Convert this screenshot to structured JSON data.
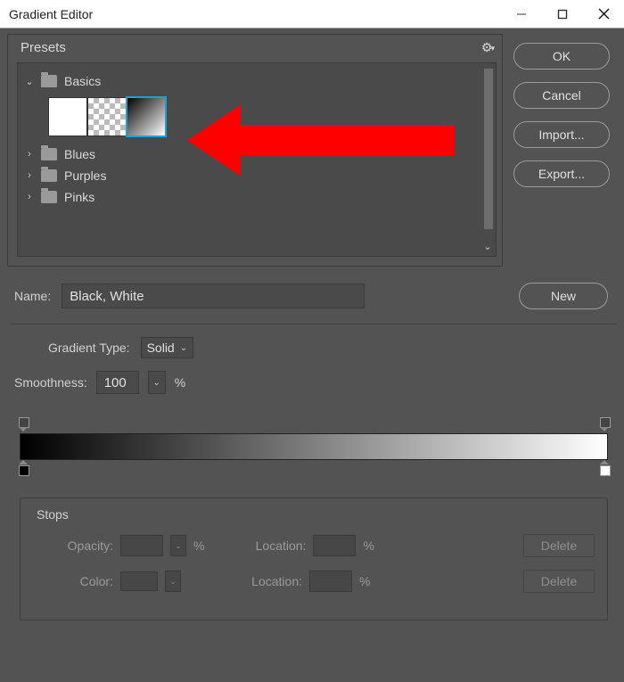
{
  "window": {
    "title": "Gradient Editor"
  },
  "buttons": {
    "ok": "OK",
    "cancel": "Cancel",
    "import": "Import...",
    "export": "Export...",
    "new": "New",
    "delete": "Delete"
  },
  "presets": {
    "label": "Presets",
    "folders": [
      {
        "name": "Basics",
        "expanded": true
      },
      {
        "name": "Blues",
        "expanded": false
      },
      {
        "name": "Purples",
        "expanded": false
      },
      {
        "name": "Pinks",
        "expanded": false
      }
    ]
  },
  "name": {
    "label": "Name:",
    "value": "Black, White"
  },
  "gradient_type": {
    "label": "Gradient Type:",
    "value": "Solid"
  },
  "smoothness": {
    "label": "Smoothness:",
    "value": "100",
    "unit": "%"
  },
  "stops": {
    "title": "Stops",
    "opacity_label": "Opacity:",
    "color_label": "Color:",
    "location_label": "Location:",
    "unit": "%"
  },
  "gradient": {
    "color_stops": [
      {
        "position": 0,
        "color": "#000000"
      },
      {
        "position": 100,
        "color": "#ffffff"
      }
    ],
    "opacity_stops": [
      {
        "position": 0,
        "opacity": 100
      },
      {
        "position": 100,
        "opacity": 100
      }
    ]
  }
}
